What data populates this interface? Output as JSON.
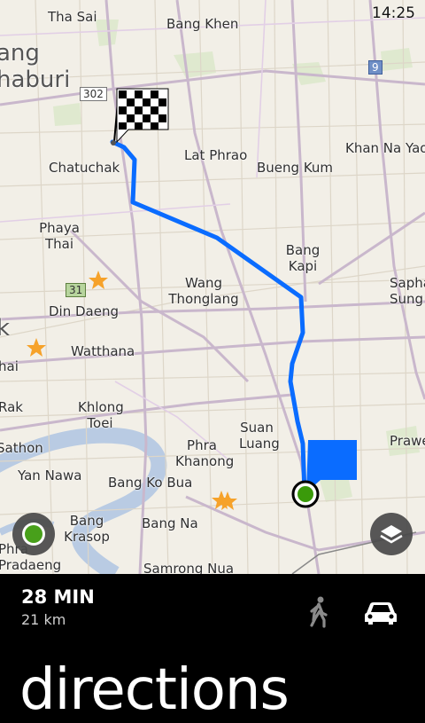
{
  "status": {
    "time": "14:25"
  },
  "map": {
    "places": {
      "tha_sai": "Tha Sai",
      "bang_khen": "Bang Khen",
      "ang": "ang",
      "haburi": "haburi",
      "chatuchak": "Chatuchak",
      "lat_phrao": "Lat Phrao",
      "bueng_kum": "Bueng Kum",
      "khan_na_yao": "Khan Na Yao",
      "phaya_thai": "Phaya Thai",
      "bang_kapi": "Bang Kapi",
      "saphan_sung": "Saphan Sung",
      "din_daeng": "Din Daeng",
      "wang_thonglang": "Wang Thonglang",
      "k": "k",
      "watthana": "Watthana",
      "hai": "hai",
      "rak": "Rak",
      "khlong_toei": "Khlong Toei",
      "suan_luang": "Suan Luang",
      "phra_khanong": "Phra Khanong",
      "prawet": "Prawe",
      "sathon": "Sathon",
      "yan_nawa": "Yan Nawa",
      "bang_ko_bua": "Bang Ko Bua",
      "bang_na": "Bang Na",
      "bang_krasop": "Bang Krasop",
      "phra_pradaeng": "Phra Pradaeng",
      "samrong_nua": "Samrong Nua"
    },
    "shields": {
      "r302": "302",
      "r31": "31",
      "r9": "9"
    },
    "colors": {
      "route": "#0a6cff",
      "destination_flag": "#0a6cff",
      "position_dot": "#3a9a0a",
      "park": "#dfe9cf",
      "water": "#b9cbe3"
    }
  },
  "controls": {
    "locate_icon": "my-location-icon",
    "layers_icon": "map-layers-icon"
  },
  "directions": {
    "duration": "28 MIN",
    "distance": "21 km",
    "modes": [
      {
        "icon": "walk-icon",
        "selected": false
      },
      {
        "icon": "car-icon",
        "selected": true
      }
    ],
    "title": "directions"
  }
}
